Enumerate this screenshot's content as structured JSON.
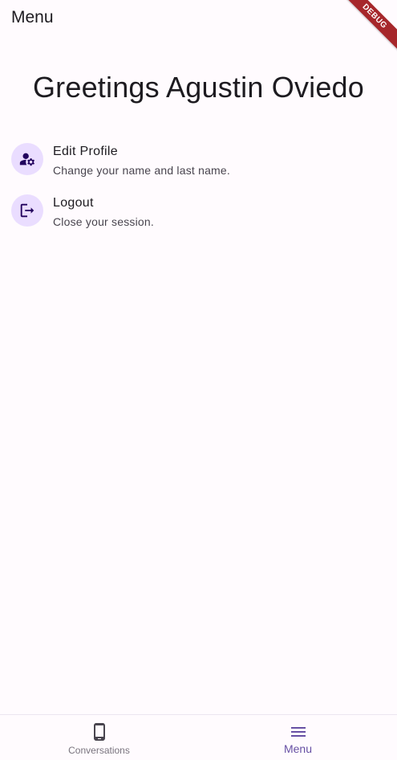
{
  "appbar": {
    "title": "Menu"
  },
  "debug_banner": {
    "label": "DEBUG"
  },
  "greeting": "Greetings Agustin Oviedo",
  "menu": {
    "items": [
      {
        "title": "Edit Profile",
        "subtitle": "Change your name and last name.",
        "icon": "manage-accounts-icon"
      },
      {
        "title": "Logout",
        "subtitle": "Close your session.",
        "icon": "logout-icon"
      }
    ]
  },
  "bottom_nav": {
    "items": [
      {
        "label": "Conversations",
        "icon": "phone-android-icon",
        "selected": false
      },
      {
        "label": "Menu",
        "icon": "menu-icon",
        "selected": true
      }
    ]
  },
  "colors": {
    "background": "#fffbfe",
    "primary": "#6750a4",
    "icon_container": "#eaddff",
    "debug_banner": "#a6272b"
  }
}
